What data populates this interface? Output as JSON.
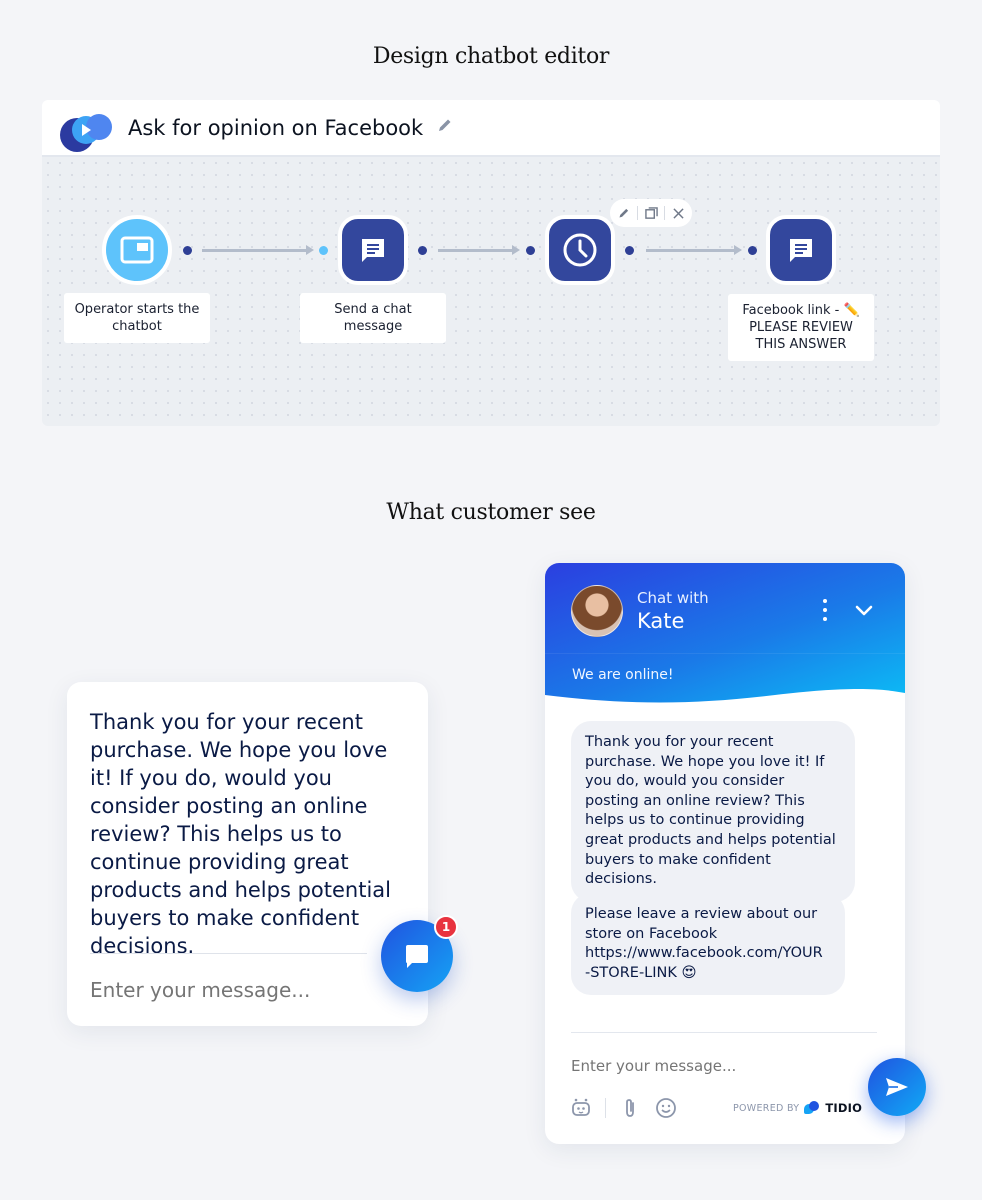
{
  "sections": {
    "editor_title": "Design chatbot editor",
    "customer_title": "What customer see"
  },
  "editor": {
    "flow_name": "Ask for opinion on Facebook",
    "edit_icon": "pencil-icon",
    "nodes": [
      {
        "type": "trigger",
        "icon": "window-icon",
        "label": "Operator starts the chatbot"
      },
      {
        "type": "action",
        "icon": "chat-message-icon",
        "label": "Send a chat message"
      },
      {
        "type": "delay",
        "icon": "clock-icon",
        "label": ""
      },
      {
        "type": "action",
        "icon": "chat-message-icon",
        "label": "Facebook link - ✏️ PLEASE REVIEW THIS ANSWER"
      }
    ],
    "node_toolbar": {
      "items": [
        "pencil-icon",
        "duplicate-icon",
        "close-icon"
      ]
    }
  },
  "preview_widget": {
    "message": "Thank you for your recent purchase. We hope you love it! If you do, would you consider posting an online review? This helps us to continue providing great products and helps potential buyers to make confident decisions.",
    "input_placeholder": "Enter your message...",
    "launcher_icon": "chat-bubble-icon",
    "unread_count": "1"
  },
  "chat_window": {
    "header_subtitle": "Chat with",
    "agent_name": "Kate",
    "status": "We are online!",
    "messages": [
      {
        "text": "Thank you for your recent purchase. We hope you love it! If you do, would you consider posting an online review? This helps us to continue providing great products and helps potential buyers to make confident decisions."
      },
      {
        "text": "Please leave a review about our store on Facebook https://www.facebook.com/YOUR -STORE-LINK 😍"
      }
    ],
    "input_placeholder": "Enter your message...",
    "powered_by": "POWERED BY",
    "brand": "TIDIO",
    "colors": {
      "header_start": "#2b3fe0",
      "header_end": "#0bc0f6",
      "bubble_bg": "#eff1f6",
      "badge": "#e8333f"
    }
  }
}
